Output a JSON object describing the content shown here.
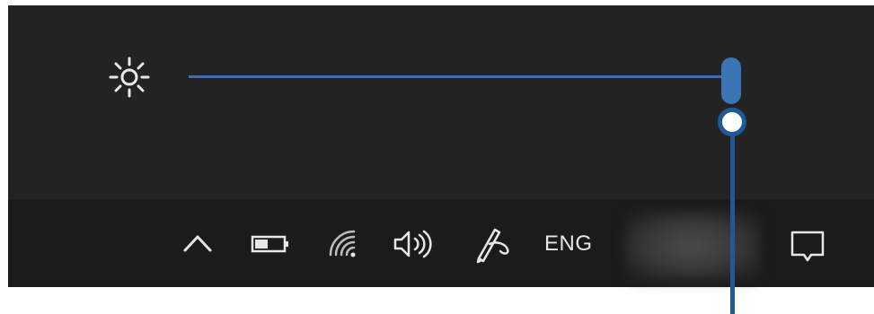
{
  "flyout": {
    "brightness": {
      "icon": "sun-icon",
      "level": 1.0,
      "accent_color": "#3b75b5"
    }
  },
  "taskbar": {
    "tray_icons": [
      "chevron-up-icon",
      "battery-icon",
      "wifi-icon",
      "volume-icon",
      "pen-icon"
    ],
    "language": "ENG",
    "notification_icon": "notification-icon"
  },
  "annotation": {
    "callout_color": "#1f5a96"
  }
}
